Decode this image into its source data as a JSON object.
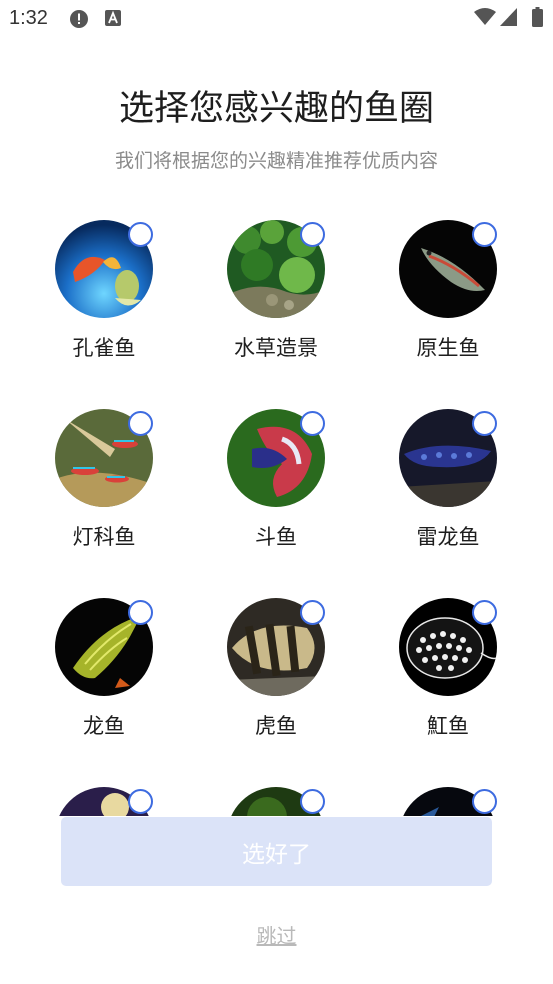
{
  "status_bar": {
    "time": "1:32",
    "icons": [
      "alert-icon",
      "a-icon",
      "wifi-icon",
      "signal-icon",
      "battery-icon"
    ]
  },
  "page": {
    "title": "选择您感兴趣的鱼圈",
    "subtitle": "我们将根据您的兴趣精准推荐优质内容"
  },
  "categories": [
    {
      "label": "孔雀鱼",
      "selected": false
    },
    {
      "label": "水草造景",
      "selected": false
    },
    {
      "label": "原生鱼",
      "selected": false
    },
    {
      "label": "灯科鱼",
      "selected": false
    },
    {
      "label": "斗鱼",
      "selected": false
    },
    {
      "label": "雷龙鱼",
      "selected": false
    },
    {
      "label": "龙鱼",
      "selected": false
    },
    {
      "label": "虎鱼",
      "selected": false
    },
    {
      "label": "魟鱼",
      "selected": false
    },
    {
      "label": "",
      "selected": false
    },
    {
      "label": "",
      "selected": false
    },
    {
      "label": "",
      "selected": false
    }
  ],
  "actions": {
    "confirm_label": "选好了",
    "skip_label": "跳过"
  },
  "colors": {
    "accent": "#3d6be0",
    "button_bg": "#dbe3f8",
    "title": "#1e1e1e",
    "subtitle": "#8b8b8b",
    "skip": "#b9b9b9"
  }
}
